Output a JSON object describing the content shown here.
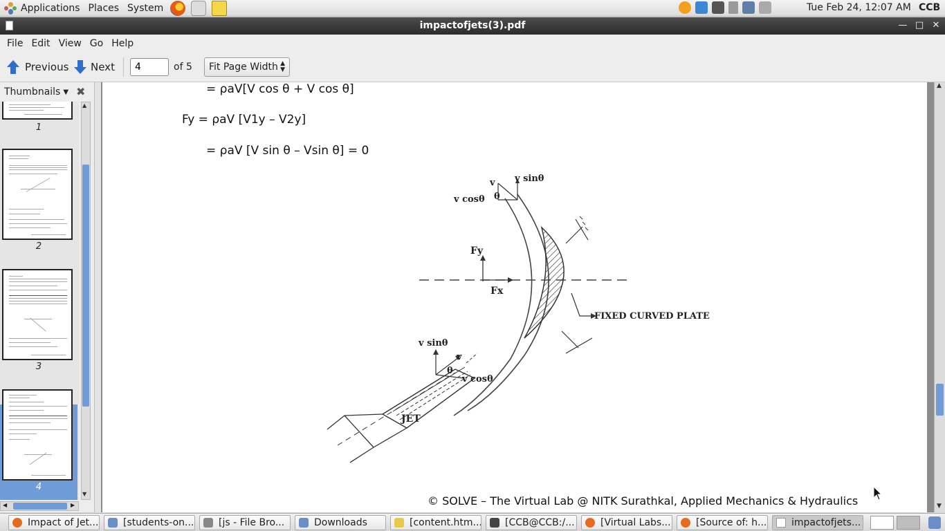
{
  "top_panel": {
    "menus": [
      "Applications",
      "Places",
      "System"
    ],
    "clock": "Tue Feb 24, 12:07 AM",
    "user": "CCB"
  },
  "window": {
    "title": "impactofjets(3).pdf",
    "min_icon": "minimize-icon",
    "max_icon": "maximize-icon",
    "close_icon": "close-icon"
  },
  "menubar": [
    "File",
    "Edit",
    "View",
    "Go",
    "Help"
  ],
  "toolbar": {
    "previous_label": "Previous",
    "next_label": "Next",
    "page_value": "4",
    "page_of": "of 5",
    "zoom_value": "Fit Page Width"
  },
  "sidebar": {
    "header_label": "Thumbnails",
    "thumbnails": [
      {
        "label": "1"
      },
      {
        "label": "2"
      },
      {
        "label": "3"
      },
      {
        "label": "4",
        "selected": true
      }
    ]
  },
  "document": {
    "equations": [
      "= ρaV[V cos θ + V cos θ]",
      "Fy = ρaV [V1y – V2y]",
      "= ρaV [V sin θ – Vsin θ] = 0"
    ],
    "diagram_labels": {
      "v_top": "v",
      "v_sin_top": "v sinθ",
      "v_cos_top": "v cosθ",
      "theta_top": "θ",
      "fy": "Fy",
      "fx": "Fx",
      "plate": "FIXED CURVED PLATE",
      "v_sin_bottom": "v sinθ",
      "v_bottom": "v",
      "theta_bottom": "θ",
      "v_cos_bottom": "v cosθ",
      "jet": "JET"
    },
    "footer": "© SOLVE – The Virtual Lab @ NITK Surathkal, Applied Mechanics & Hydraulics"
  },
  "taskbar": {
    "tasks": [
      {
        "label": "Impact of Jet...",
        "icon": "firefox-icon",
        "color": "#e66a1f"
      },
      {
        "label": "[students-on...",
        "icon": "folder-icon",
        "color": "#6a8fc8"
      },
      {
        "label": "[js - File Bro...",
        "icon": "file-browser-icon",
        "color": "#888888"
      },
      {
        "label": "Downloads",
        "icon": "folder-icon",
        "color": "#6a8fc8"
      },
      {
        "label": "[content.htm...",
        "icon": "text-editor-icon",
        "color": "#e9c94a"
      },
      {
        "label": "[CCB@CCB:/...",
        "icon": "terminal-icon",
        "color": "#444444"
      },
      {
        "label": "[Virtual Labs...",
        "icon": "firefox-icon",
        "color": "#e66a1f"
      },
      {
        "label": "[Source of: h...",
        "icon": "firefox-icon",
        "color": "#e66a1f"
      },
      {
        "label": "impactofjets...",
        "icon": "pdf-viewer-icon",
        "color": "#cccccc",
        "active": true
      }
    ]
  }
}
